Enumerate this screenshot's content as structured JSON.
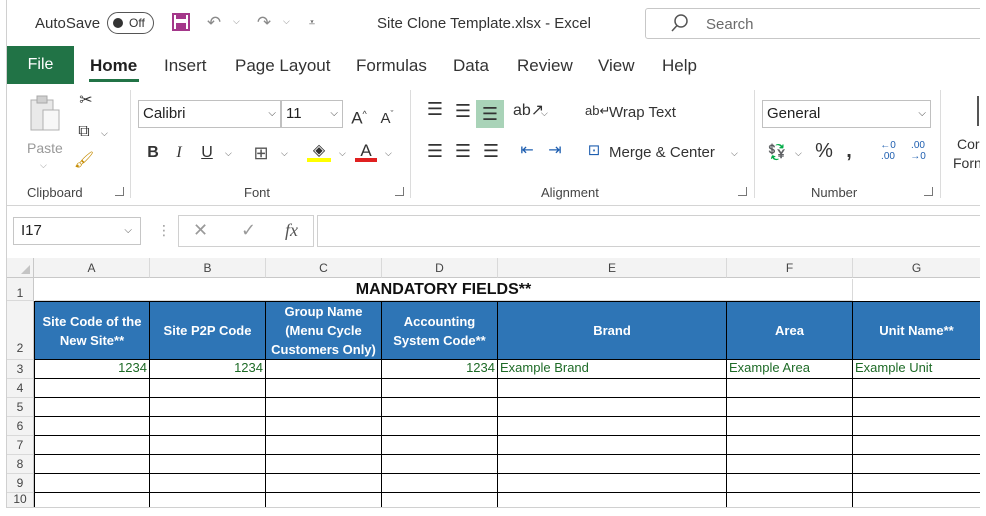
{
  "titlebar": {
    "autosave_label": "AutoSave",
    "autosave_state": "Off",
    "document_title": "Site Clone Template.xlsx  -  Excel",
    "search_placeholder": "Search"
  },
  "tabs": [
    {
      "label": "File"
    },
    {
      "label": "Home"
    },
    {
      "label": "Insert"
    },
    {
      "label": "Page Layout"
    },
    {
      "label": "Formulas"
    },
    {
      "label": "Data"
    },
    {
      "label": "Review"
    },
    {
      "label": "View"
    },
    {
      "label": "Help"
    }
  ],
  "ribbon": {
    "clipboard": {
      "label": "Clipboard",
      "paste_label": "Paste"
    },
    "font": {
      "label": "Font",
      "font_name": "Calibri",
      "font_size": "11",
      "bold": "B",
      "italic": "I",
      "underline": "U"
    },
    "alignment": {
      "label": "Alignment",
      "wrap_text": "Wrap Text",
      "merge_center": "Merge & Center"
    },
    "number": {
      "label": "Number",
      "format": "General"
    },
    "styles": {
      "cond_format_line1": "Cor",
      "cond_format_line2": "Forn"
    }
  },
  "formula_bar": {
    "name_box": "I17",
    "fx": "fx",
    "formula": ""
  },
  "columns": [
    "A",
    "B",
    "C",
    "D",
    "E",
    "F",
    "G"
  ],
  "rows": [
    "1",
    "2",
    "3",
    "4",
    "5",
    "6",
    "7",
    "8",
    "9",
    "10"
  ],
  "sheet": {
    "banner": "MANDATORY FIELDS**",
    "headers": [
      "Site Code of the New Site**",
      "Site P2P Code",
      "Group Name (Menu Cycle Customers Only)",
      "Accounting System Code**",
      "Brand",
      "Area",
      "Unit Name**"
    ],
    "row3": [
      "1234",
      "1234",
      "",
      "1234",
      "Example Brand",
      "Example Area",
      "Example Unit"
    ]
  },
  "colors": {
    "excel_green": "#217346",
    "header_blue": "#2e75b6",
    "data_green": "#1e6b27"
  }
}
